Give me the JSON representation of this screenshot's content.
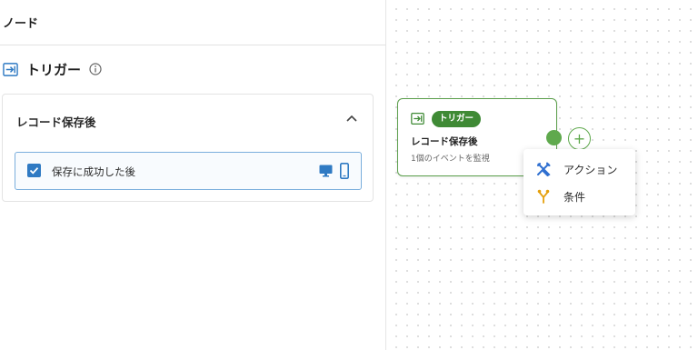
{
  "panel": {
    "title": "ノード"
  },
  "section": {
    "title": "トリガー",
    "trigger_icon": "trigger-enter-icon",
    "info_icon": "info-icon"
  },
  "card": {
    "title": "レコード保存後",
    "expanded": true,
    "option": {
      "label": "保存に成功した後",
      "checked": true,
      "platforms": [
        "desktop-icon",
        "mobile-icon"
      ]
    }
  },
  "node": {
    "badge": "トリガー",
    "title": "レコード保存後",
    "subtitle": "1個のイベントを監視",
    "accent": "#3f8a35",
    "border": "#5a9e4a"
  },
  "add_menu": {
    "items": [
      {
        "label": "アクション",
        "icon": "tools-icon",
        "color": "#2f6fd0"
      },
      {
        "label": "条件",
        "icon": "branch-icon",
        "color": "#e5a00d"
      }
    ]
  },
  "colors": {
    "primary_blue": "#2f7ac3",
    "green": "#5fa94d"
  }
}
